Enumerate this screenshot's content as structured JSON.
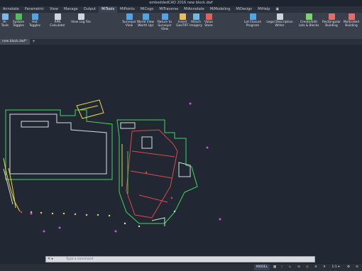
{
  "window": {
    "title": "embeddedCAD 2016    new block.dwf"
  },
  "ribbon_tabs": [
    "Annotate",
    "Parametric",
    "View",
    "Manage",
    "Output",
    "MiTools",
    "MiPoints",
    "MiCogo",
    "MiTraverse",
    "MiAnnotate",
    "MiModeling",
    "MiDesign",
    "MiHelp",
    "▣"
  ],
  "active_tab_index": 5,
  "ribbon_buttons": [
    {
      "label": "Hi-\nTools",
      "color": "#7fb6e8"
    },
    {
      "label": "System\nToggles",
      "color": "#47c35b"
    },
    {
      "label": "Hot\nToggles",
      "color": "#4da6e8"
    },
    {
      "label": "RPN\nCalculator",
      "color": "#cfd5dd"
    },
    {
      "label": "View Log File",
      "color": "#cfd5dd"
    },
    {
      "label": "Surveyor\nView",
      "color": "#4da6e8"
    },
    {
      "label": "World View\n(North Up)",
      "color": "#4da6e8"
    },
    {
      "label": "Return to\nSurveyor View",
      "color": "#4da6e8"
    },
    {
      "label": "Insert\nGeoTIFF",
      "color": "#e8c04d"
    },
    {
      "label": "Attach\nImagery",
      "color": "#6bbde8"
    },
    {
      "label": "Value\nStore",
      "color": "#e85d5d"
    },
    {
      "label": "Lot Closure\nProgram",
      "color": "#4da6e8"
    },
    {
      "label": "Legal Description\nWriter",
      "color": "#cfd5dd"
    },
    {
      "label": "Create/Edit\nLots & Blocks",
      "color": "#7ad36b"
    },
    {
      "label": "Rectangular\nBuilding",
      "color": "#e86b6b"
    },
    {
      "label": "Multisided\nBuilding",
      "color": "#e86b6b"
    }
  ],
  "ribbon_groups": [
    "Defaults",
    "Calculators",
    "Reports ▾",
    "Layer Control ▾",
    "View Rotation",
    "Imagery",
    "Wizards",
    "Subdivision",
    "Buildings ▾"
  ],
  "document_tabs": [
    {
      "label": "new block.dwf*"
    }
  ],
  "command_line": {
    "placeholder": "Type a command"
  },
  "status_bar": {
    "model_label": "MODEL",
    "scale": "1:1 ▾"
  },
  "colors": {
    "background": "#222833",
    "green": "#3fd65c",
    "red": "#e04848",
    "white": "#d8dde3",
    "yellow": "#e8d84a",
    "magenta": "#d04ce0"
  }
}
